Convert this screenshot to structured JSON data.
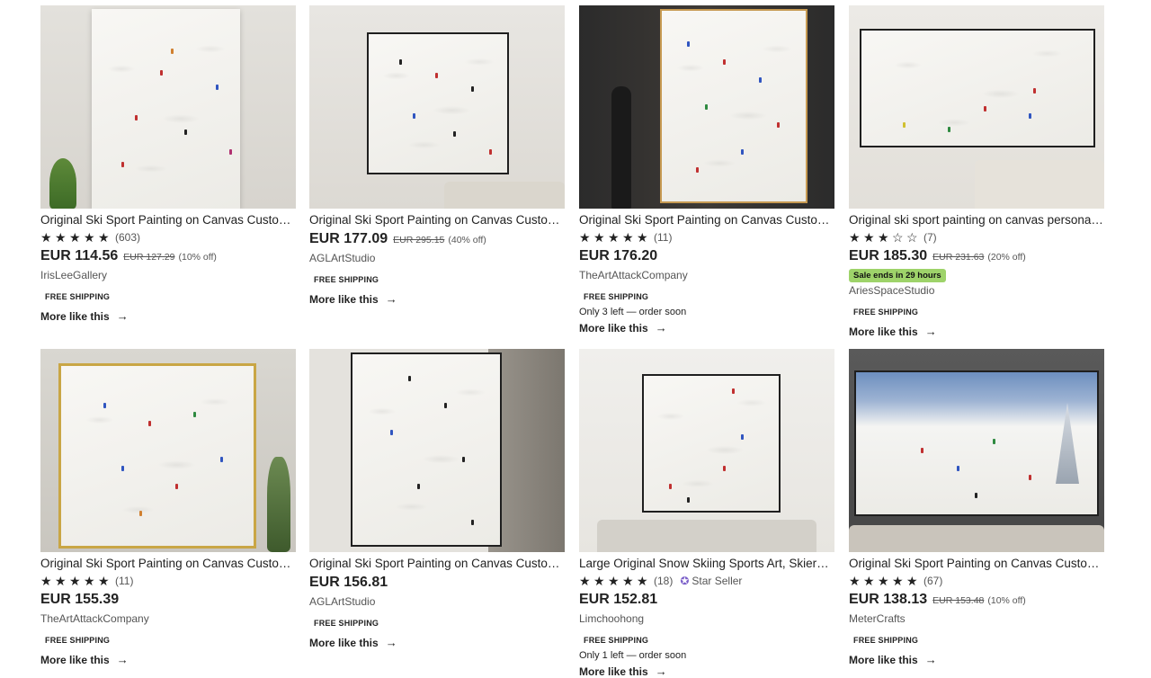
{
  "listings": [
    {
      "title": "Original Ski Sport Painting on Canvas Custom ...",
      "rating_count": "(603)",
      "stars": "5",
      "price": "EUR 114.56",
      "original_price": "EUR 127.29",
      "discount": "(10% off)",
      "shop": "IrisLeeGallery",
      "shipping": "FREE shipping",
      "more": "More like this"
    },
    {
      "title": "Original Ski Sport Painting on Canvas Custom ...",
      "price": "EUR 177.09",
      "original_price": "EUR 295.15",
      "discount": "(40% off)",
      "shop": "AGLArtStudio",
      "shipping": "FREE shipping",
      "more": "More like this"
    },
    {
      "title": "Original Ski Sport Painting on Canvas Custom ...",
      "rating_count": "(11)",
      "stars": "5",
      "price": "EUR 176.20",
      "shop": "TheArtAttackCompany",
      "shipping": "FREE shipping",
      "stock": "Only 3 left — order soon",
      "more": "More like this"
    },
    {
      "title": "Original ski sport painting on canvas personali...",
      "rating_count": "(7)",
      "stars": "3",
      "price": "EUR 185.30",
      "original_price": "EUR 231.63",
      "discount": "(20% off)",
      "sale": "Sale ends in 29 hours",
      "shop": "AriesSpaceStudio",
      "shipping": "FREE shipping",
      "more": "More like this"
    },
    {
      "title": "Original Ski Sport Painting on Canvas Custom ...",
      "rating_count": "(11)",
      "stars": "5",
      "price": "EUR 155.39",
      "shop": "TheArtAttackCompany",
      "shipping": "FREE shipping",
      "more": "More like this"
    },
    {
      "title": "Original Ski Sport Painting on Canvas Custom ...",
      "price": "EUR 156.81",
      "shop": "AGLArtStudio",
      "shipping": "FREE shipping",
      "more": "More like this"
    },
    {
      "title": "Large Original Snow Skiing Sports Art, Skiers O...",
      "rating_count": "(18)",
      "stars": "5",
      "star_seller": "Star Seller",
      "price": "EUR 152.81",
      "shop": "Limchoohong",
      "shipping": "FREE shipping",
      "stock": "Only 1 left — order soon",
      "more": "More like this"
    },
    {
      "title": "Original Ski Sport Painting on Canvas Custom ...",
      "rating_count": "(67)",
      "stars": "5",
      "price": "EUR 138.13",
      "original_price": "EUR 153.48",
      "discount": "(10% off)",
      "shop": "MeterCrafts",
      "shipping": "FREE shipping",
      "more": "More like this"
    }
  ],
  "icons": {
    "star_full": "★",
    "star_empty": "☆",
    "arrow": "→",
    "star_seller": "✪"
  }
}
